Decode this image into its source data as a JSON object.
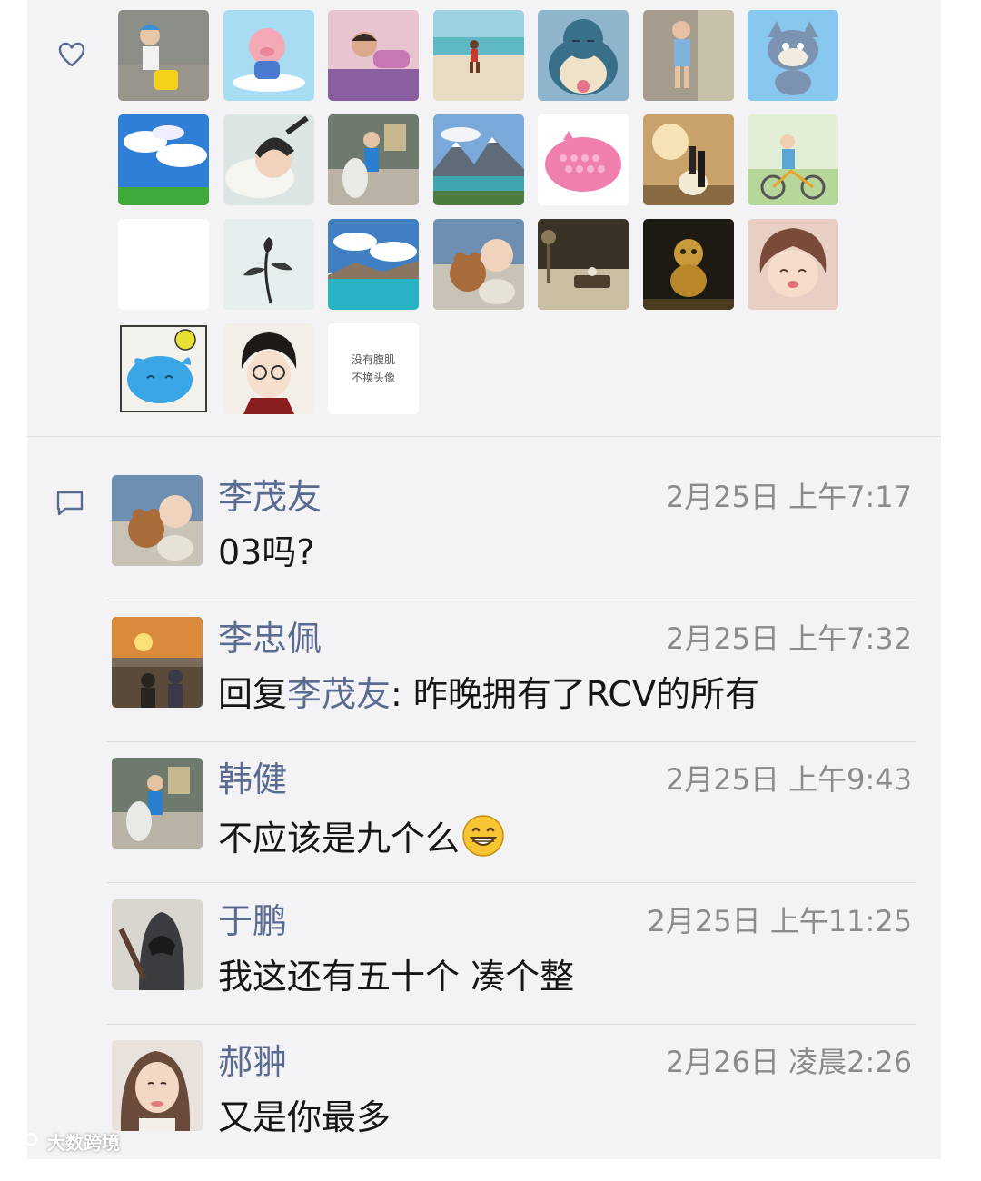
{
  "likes": {
    "icon": "heart-outline-icon",
    "avatars": [
      {
        "name": "avatar-boy-toy-car"
      },
      {
        "name": "avatar-pink-pig"
      },
      {
        "name": "avatar-girl-lying"
      },
      {
        "name": "avatar-beach-runner"
      },
      {
        "name": "avatar-snorlax"
      },
      {
        "name": "avatar-girl-wall"
      },
      {
        "name": "avatar-tom-cat"
      },
      {
        "name": "avatar-blue-sky"
      },
      {
        "name": "avatar-baby-hat"
      },
      {
        "name": "avatar-boy-rocking-horse"
      },
      {
        "name": "avatar-mountain-lake"
      },
      {
        "name": "avatar-pink-popit-pig"
      },
      {
        "name": "avatar-wedding-sunset"
      },
      {
        "name": "avatar-cyclist"
      },
      {
        "name": "avatar-blank"
      },
      {
        "name": "avatar-ink-flower"
      },
      {
        "name": "avatar-lake-clouds"
      },
      {
        "name": "avatar-baby-teddy"
      },
      {
        "name": "avatar-tea-table"
      },
      {
        "name": "avatar-monkey-statue"
      },
      {
        "name": "avatar-anime-girl"
      },
      {
        "name": "avatar-blue-bird"
      },
      {
        "name": "avatar-boy-glasses"
      },
      {
        "name": "avatar-text-card",
        "text1": "没有腹肌",
        "text2": "不换头像"
      }
    ]
  },
  "comments_icon": "comment-bubble-icon",
  "comments": [
    {
      "name": "李茂友",
      "time": "2月25日 上午7:17",
      "text": "03吗?",
      "avatar": "avatar-baby-teddy"
    },
    {
      "name": "李忠佩",
      "time": "2月25日 上午7:32",
      "reply_prefix": "回复",
      "reply_to": "李茂友",
      "reply_sep": ": ",
      "text": "昨晚拥有了RCV的所有",
      "avatar": "avatar-sunset-group"
    },
    {
      "name": "韩健",
      "time": "2月25日 上午9:43",
      "text": "不应该是九个么",
      "emoji": "grin-emoji-icon",
      "avatar": "avatar-boy-rocking-horse"
    },
    {
      "name": "于鹏",
      "time": "2月25日 上午11:25",
      "text": "我这还有五十个 凑个整",
      "avatar": "avatar-assassin"
    },
    {
      "name": "郝翀",
      "time": "2月26日 凌晨2:26",
      "text": "又是你最多",
      "avatar": "avatar-woman-selfie"
    }
  ],
  "watermark": "大数跨境",
  "colors": {
    "link": "#5a6b91",
    "panel": "#f3f3f5",
    "timestamp": "#8b8b8d"
  }
}
